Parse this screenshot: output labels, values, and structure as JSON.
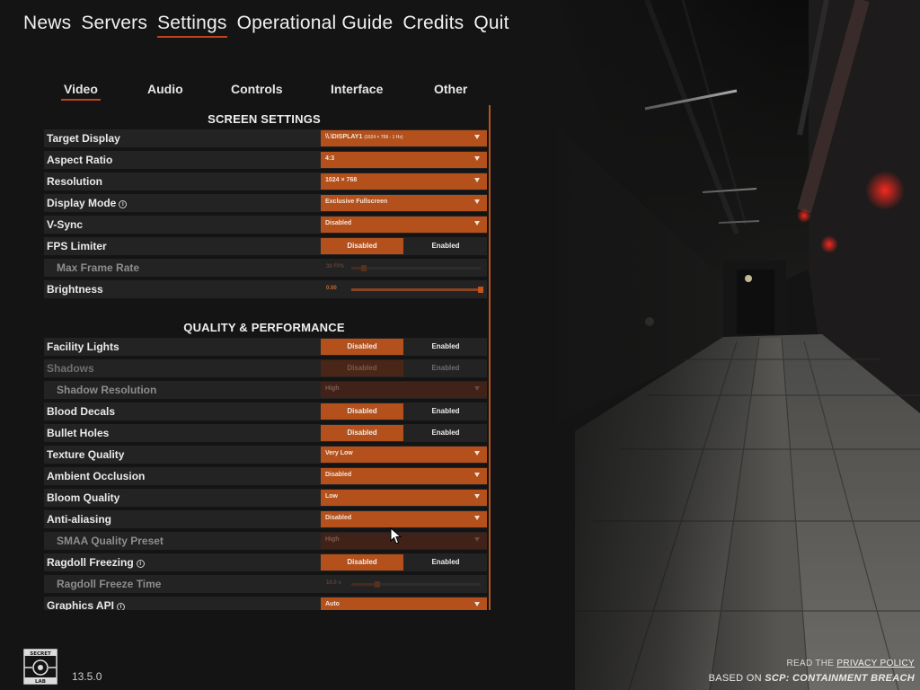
{
  "nav": {
    "items": [
      "News",
      "Servers",
      "Settings",
      "Operational Guide",
      "Credits",
      "Quit"
    ],
    "active": "Settings"
  },
  "tabs": {
    "items": [
      "Video",
      "Audio",
      "Controls",
      "Interface",
      "Other"
    ],
    "active": "Video"
  },
  "screen_settings": {
    "title": "SCREEN SETTINGS",
    "target_display": {
      "label": "Target Display",
      "value": "\\\\.\\DISPLAY1",
      "detail": "(1024 × 768 - 1 Hz)"
    },
    "aspect_ratio": {
      "label": "Aspect Ratio",
      "value": "4:3"
    },
    "resolution": {
      "label": "Resolution",
      "value": "1024 × 768"
    },
    "display_mode": {
      "label": "Display Mode",
      "value": "Exclusive Fullscreen"
    },
    "vsync": {
      "label": "V-Sync",
      "value": "Disabled"
    },
    "fps_limiter": {
      "label": "FPS Limiter",
      "off": "Disabled",
      "on": "Enabled"
    },
    "max_frame_rate": {
      "label": "Max Frame Rate",
      "value": "30 FPS",
      "level": 0.1
    },
    "brightness": {
      "label": "Brightness",
      "value": "0.00",
      "level": 1.0
    }
  },
  "quality": {
    "title": "QUALITY & PERFORMANCE",
    "facility_lights": {
      "label": "Facility Lights",
      "off": "Disabled",
      "on": "Enabled"
    },
    "shadows": {
      "label": "Shadows",
      "off": "Disabled",
      "on": "Enabled"
    },
    "shadow_resolution": {
      "label": "Shadow Resolution",
      "value": "High"
    },
    "blood_decals": {
      "label": "Blood Decals",
      "off": "Disabled",
      "on": "Enabled"
    },
    "bullet_holes": {
      "label": "Bullet Holes",
      "off": "Disabled",
      "on": "Enabled"
    },
    "texture_quality": {
      "label": "Texture Quality",
      "value": "Very Low"
    },
    "ambient_occlusion": {
      "label": "Ambient Occlusion",
      "value": "Disabled"
    },
    "bloom_quality": {
      "label": "Bloom Quality",
      "value": "Low"
    },
    "anti_aliasing": {
      "label": "Anti-aliasing",
      "value": "Disabled"
    },
    "smaa_preset": {
      "label": "SMAA Quality Preset",
      "value": "High"
    },
    "ragdoll_freezing": {
      "label": "Ragdoll Freezing",
      "off": "Disabled",
      "on": "Enabled"
    },
    "ragdoll_freeze_time": {
      "label": "Ragdoll Freeze Time",
      "value": "10.0 s",
      "level": 0.2
    },
    "graphics_api": {
      "label": "Graphics API",
      "value": "Auto"
    }
  },
  "footer": {
    "logo_text": "SECRET LAB",
    "version": "13.5.0",
    "read_the": "READ THE",
    "privacy_policy": "PRIVACY POLICY",
    "based_on": "BASED ON",
    "game_name": "SCP: CONTAINMENT BREACH"
  },
  "colors": {
    "accent": "#b3501b",
    "underline": "#c2431f",
    "panel_row": "#232323",
    "background": "#141414"
  }
}
